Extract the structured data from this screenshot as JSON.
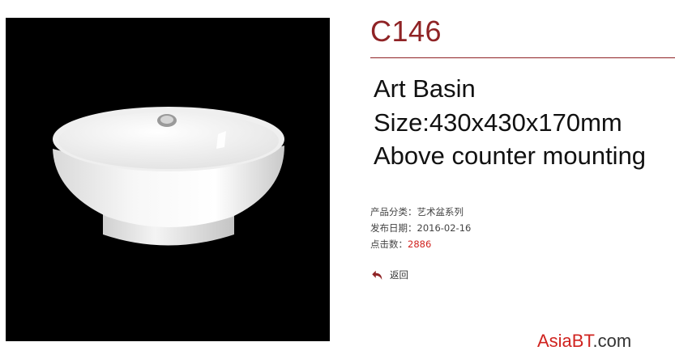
{
  "product": {
    "code": "C146",
    "name": "Art Basin",
    "size": "Size:430x430x170mm",
    "mounting": "Above counter mounting"
  },
  "meta": {
    "category_label": "产品分类：",
    "category_value": "艺术盆系列",
    "date_label": "发布日期：",
    "date_value": "2016-02-16",
    "clicks_label": "点击数：",
    "clicks_value": "2886"
  },
  "back_label": "返回",
  "watermark": {
    "brand": "AsiaBT",
    "suffix": ".com"
  },
  "colors": {
    "accent": "#8f2325",
    "count": "#d0231f",
    "background": "#ffffff",
    "photo_bg": "#000000"
  },
  "icons": {
    "back": "back-arrow-icon"
  }
}
